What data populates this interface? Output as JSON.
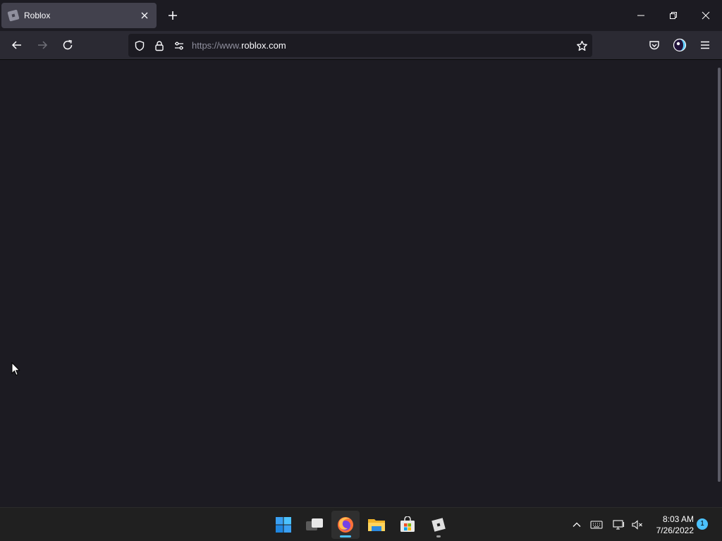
{
  "browser": {
    "tab": {
      "title": "Roblox",
      "favicon": "roblox-logo-icon"
    },
    "new_tab_icon": "plus-icon",
    "window_controls": [
      "minimize-icon",
      "restore-icon",
      "close-icon"
    ],
    "nav": {
      "back_icon": "arrow-left-icon",
      "forward_icon": "arrow-right-icon",
      "reload_icon": "reload-icon"
    },
    "urlbar": {
      "prefix": "https://www.",
      "host": "roblox.com",
      "icons": [
        "shield-icon",
        "lock-icon",
        "permissions-icon",
        "star-icon"
      ]
    },
    "toolbar_icons": [
      "pocket-icon",
      "account-icon",
      "menu-icon"
    ]
  },
  "content": {
    "background": "#1c1b22"
  },
  "taskbar": {
    "apps": [
      "start-icon",
      "task-view-icon",
      "firefox-icon",
      "file-explorer-icon",
      "store-icon",
      "roblox-icon"
    ],
    "active_app": "firefox-icon",
    "tray_icons": [
      "chevron-up-icon",
      "keyboard-icon",
      "network-icon",
      "volume-muted-icon"
    ],
    "clock": {
      "time": "8:03 AM",
      "date": "7/26/2022"
    },
    "notification_count": "1"
  },
  "colors": {
    "accent": "#4cc2ff",
    "tab_active": "#42414d",
    "toolbar": "#2b2a33",
    "page": "#1c1b22",
    "taskbar": "#202020"
  }
}
